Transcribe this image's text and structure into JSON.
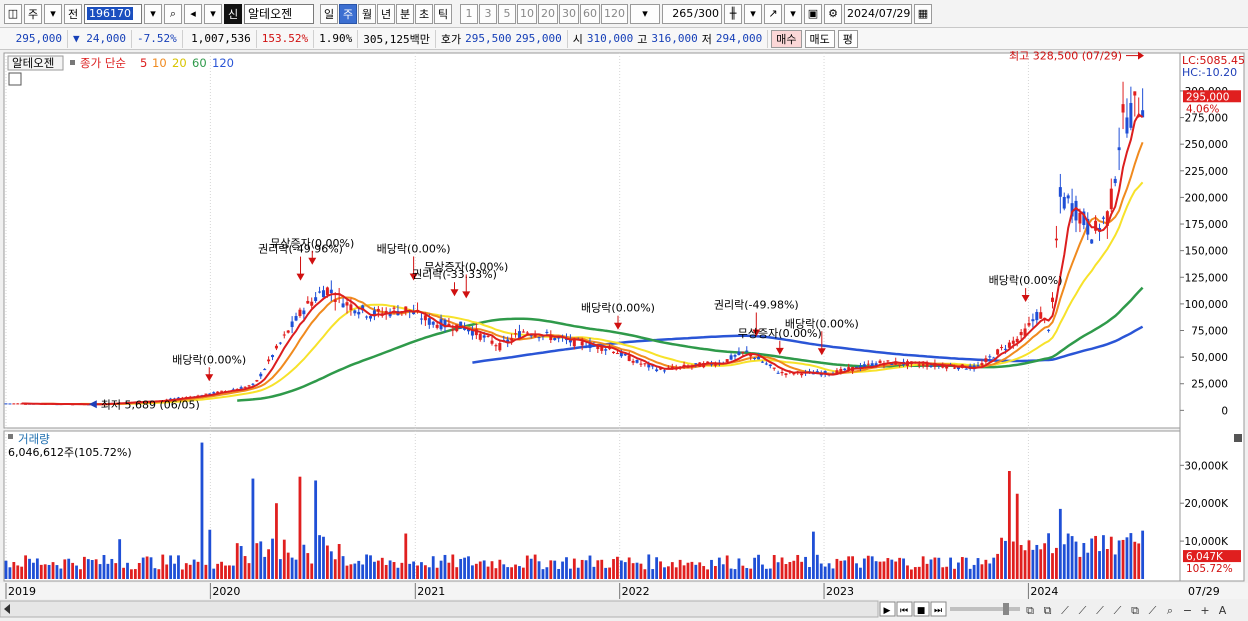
{
  "toolbar": {
    "period_short": "주",
    "prev_label": "전",
    "code": "196170",
    "badge": "신",
    "name": "알테오젠",
    "periods": [
      "일",
      "주",
      "월",
      "년",
      "분",
      "초",
      "틱"
    ],
    "selected_period": "주",
    "intervals": [
      "1",
      "3",
      "5",
      "10",
      "20",
      "30",
      "60",
      "120"
    ],
    "count": "265",
    "count_total": "/300",
    "date": "2024/07/29"
  },
  "quote": {
    "price": "295,000",
    "change": "▼ 24,000",
    "change_pct": "-7.52%",
    "volume": "1,007,536",
    "volume_ratio": "153.52%",
    "turnover": "1.90%",
    "amount": "305,125백만",
    "bid_label": "호가",
    "bid": "295,500",
    "ask": "295,000",
    "open_label": "시",
    "open": "310,000",
    "high_label": "고",
    "high": "316,000",
    "low_label": "저",
    "low": "294,000",
    "buy_label": "매수",
    "sell_label": "매도",
    "avg_label": "평"
  },
  "chart_data": [
    {
      "type": "candlestick",
      "panel": "price",
      "legend": {
        "name": "알테오젠",
        "ma_label": "종가 단순",
        "ma_periods": [
          "5",
          "10",
          "20",
          "60",
          "120"
        ],
        "ma_colors": [
          "#dc1e1e",
          "#f08a1e",
          "#f7e22a",
          "#2f9a4a",
          "#2a55d6"
        ]
      },
      "top_right": {
        "lc": "LC:5085.45",
        "hc": "HC:-10.20"
      },
      "price_label": "295,000",
      "pct_label": "4.06%",
      "y_ticks": [
        "300,000",
        "275,000",
        "250,000",
        "225,000",
        "200,000",
        "175,000",
        "150,000",
        "125,000",
        "100,000",
        "75,000",
        "50,000",
        "25,000",
        "0"
      ],
      "y_tick_values": [
        300000,
        275000,
        250000,
        225000,
        200000,
        175000,
        150000,
        125000,
        100000,
        75000,
        50000,
        25000,
        0
      ],
      "ylim": [
        -10000,
        330000
      ],
      "x_labels": [
        "2019",
        "2020",
        "2021",
        "2022",
        "2023",
        "2024",
        "07/29"
      ],
      "x_label_dates": [
        "2019-01-01",
        "2020-01-01",
        "2021-01-01",
        "2022-01-01",
        "2023-01-01",
        "2024-01-01",
        "2024-07-29"
      ],
      "date_range": [
        "2019-01-01",
        "2024-07-29"
      ],
      "high_annotation": "최고 328,500 (07/29)",
      "low_annotation": "최저 5,689 (06/05)",
      "events": [
        {
          "label": "배당락(0.00%)",
          "date": "2019-12-30"
        },
        {
          "label": "권리락(-49.96%)",
          "date": "2020-06-10"
        },
        {
          "label": "무상증자(0.00%)",
          "date": "2020-07-01"
        },
        {
          "label": "배당락(0.00%)",
          "date": "2020-12-29"
        },
        {
          "label": "권리락(-33.33%)",
          "date": "2021-03-12"
        },
        {
          "label": "무상증자(0.00%)",
          "date": "2021-04-02"
        },
        {
          "label": "배당락(0.00%)",
          "date": "2021-12-29"
        },
        {
          "label": "권리락(-49.98%)",
          "date": "2022-09-02"
        },
        {
          "label": "무상증자(0.00%)",
          "date": "2022-10-14"
        },
        {
          "label": "배당락(0.00%)",
          "date": "2022-12-28"
        },
        {
          "label": "배당락(0.00%)",
          "date": "2023-12-27"
        }
      ],
      "closes": [
        {
          "date": "2019-01-01",
          "value": 6500
        },
        {
          "date": "2019-06-05",
          "value": 5689
        },
        {
          "date": "2019-10-01",
          "value": 9000
        },
        {
          "date": "2019-12-15",
          "value": 14000
        },
        {
          "date": "2020-02-15",
          "value": 20000
        },
        {
          "date": "2020-03-20",
          "value": 24000
        },
        {
          "date": "2020-05-01",
          "value": 60000
        },
        {
          "date": "2020-06-15",
          "value": 95000
        },
        {
          "date": "2020-07-25",
          "value": 115000
        },
        {
          "date": "2020-09-01",
          "value": 100000
        },
        {
          "date": "2020-10-15",
          "value": 90000
        },
        {
          "date": "2020-12-15",
          "value": 95000
        },
        {
          "date": "2021-02-01",
          "value": 82000
        },
        {
          "date": "2021-04-01",
          "value": 78000
        },
        {
          "date": "2021-06-01",
          "value": 60000
        },
        {
          "date": "2021-07-15",
          "value": 75000
        },
        {
          "date": "2021-10-01",
          "value": 65000
        },
        {
          "date": "2021-12-15",
          "value": 58000
        },
        {
          "date": "2022-02-01",
          "value": 45000
        },
        {
          "date": "2022-03-15",
          "value": 38000
        },
        {
          "date": "2022-07-01",
          "value": 45000
        },
        {
          "date": "2022-08-15",
          "value": 55000
        },
        {
          "date": "2022-10-15",
          "value": 35000
        },
        {
          "date": "2023-01-15",
          "value": 35000
        },
        {
          "date": "2023-04-15",
          "value": 45000
        },
        {
          "date": "2023-08-01",
          "value": 42000
        },
        {
          "date": "2023-10-01",
          "value": 40000
        },
        {
          "date": "2023-11-15",
          "value": 58000
        },
        {
          "date": "2023-12-20",
          "value": 70000
        },
        {
          "date": "2024-01-20",
          "value": 92000
        },
        {
          "date": "2024-02-10",
          "value": 75000
        },
        {
          "date": "2024-02-25",
          "value": 200000
        },
        {
          "date": "2024-03-25",
          "value": 190000
        },
        {
          "date": "2024-04-25",
          "value": 165000
        },
        {
          "date": "2024-05-25",
          "value": 185000
        },
        {
          "date": "2024-06-15",
          "value": 270000
        },
        {
          "date": "2024-07-29",
          "value": 295000
        }
      ]
    },
    {
      "type": "bar",
      "panel": "volume",
      "title": "거래량",
      "subtitle": "6,046,612주(105.72%)",
      "last_label": "6,047K",
      "pct_label": "105.72%",
      "y_ticks": [
        "30,000K",
        "20,000K",
        "10,000K"
      ],
      "y_tick_values": [
        30000,
        20000,
        10000
      ],
      "ylim": [
        0,
        38000
      ],
      "unit": "K",
      "spikes": [
        {
          "date": "2019-07-22",
          "value": 10500
        },
        {
          "date": "2019-12-16",
          "value": 36000
        },
        {
          "date": "2019-12-30",
          "value": 13000
        },
        {
          "date": "2020-03-16",
          "value": 26500
        },
        {
          "date": "2020-04-27",
          "value": 20000
        },
        {
          "date": "2020-06-08",
          "value": 27000
        },
        {
          "date": "2020-07-06",
          "value": 26000
        },
        {
          "date": "2020-12-14",
          "value": 12000
        },
        {
          "date": "2022-12-12",
          "value": 12500
        },
        {
          "date": "2023-11-27",
          "value": 28500
        },
        {
          "date": "2023-12-11",
          "value": 22500
        },
        {
          "date": "2024-02-26",
          "value": 18500
        },
        {
          "date": "2024-06-24",
          "value": 11000
        }
      ]
    }
  ]
}
